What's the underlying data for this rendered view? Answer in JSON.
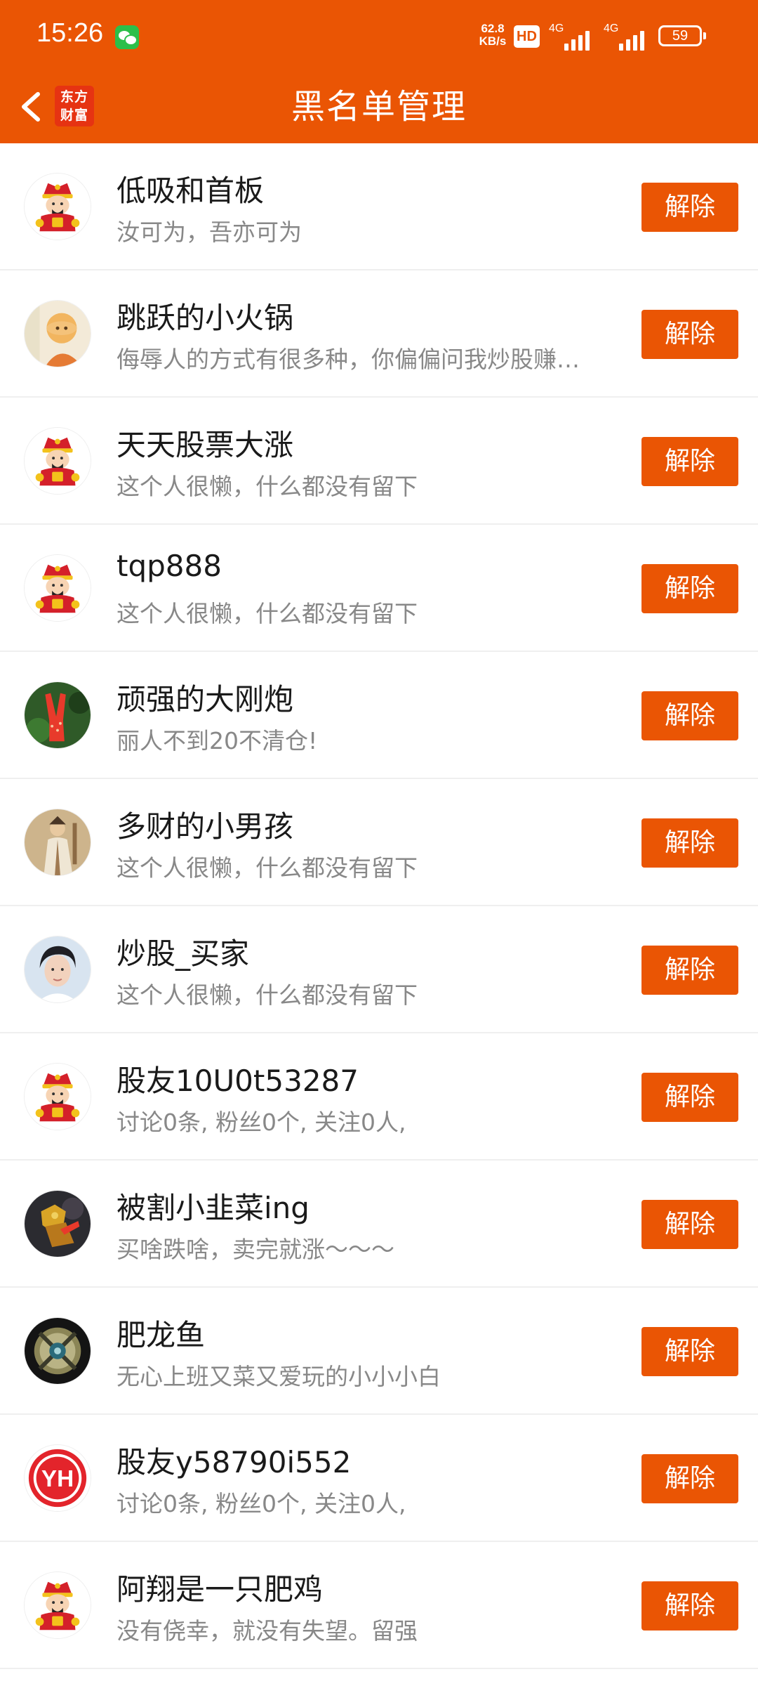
{
  "status_bar": {
    "time": "15:26",
    "net_speed_value": "62.8",
    "net_speed_unit": "KB/s",
    "hd_label": "HD",
    "network_1": "4G",
    "network_2": "4G",
    "battery": "59",
    "app_icon": "wechat-icon"
  },
  "header": {
    "title": "黑名单管理",
    "logo_line1": "东方",
    "logo_line2": "财富",
    "back_icon": "chevron-left-icon"
  },
  "colors": {
    "brand": "#ea5504",
    "button": "#ea5504",
    "name_text": "#1a1a1a",
    "bio_text": "#888888"
  },
  "blacklist": [
    {
      "name": "低吸和首板",
      "bio": "汝可为，吾亦可为",
      "avatar": "god-of-wealth-avatar",
      "action": "解除"
    },
    {
      "name": "跳跃的小火锅",
      "bio": "侮辱人的方式有很多种，你偏偏问我炒股赚…",
      "avatar": "cartoon-avatar",
      "action": "解除"
    },
    {
      "name": "天天股票大涨",
      "bio": "这个人很懒，什么都没有留下",
      "avatar": "god-of-wealth-avatar",
      "action": "解除"
    },
    {
      "name": "tqp888",
      "bio": "这个人很懒，什么都没有留下",
      "avatar": "god-of-wealth-avatar",
      "action": "解除"
    },
    {
      "name": "顽强的大刚炮",
      "bio": "丽人不到20不清仓!",
      "avatar": "victory-hand-avatar",
      "action": "解除"
    },
    {
      "name": "多财的小男孩",
      "bio": "这个人很懒，什么都没有留下",
      "avatar": "painting-avatar",
      "action": "解除"
    },
    {
      "name": "炒股_买家",
      "bio": "这个人很懒，什么都没有留下",
      "avatar": "person-photo-avatar",
      "action": "解除"
    },
    {
      "name": "股友10U0t53287",
      "bio": "讨论0条, 粉丝0个, 关注0人,",
      "avatar": "god-of-wealth-avatar",
      "action": "解除"
    },
    {
      "name": "被割小韭菜ing",
      "bio": "买啥跌啥，卖完就涨～～～",
      "avatar": "game-character-avatar",
      "action": "解除"
    },
    {
      "name": "肥龙鱼",
      "bio": "无心上班又菜又爱玩的小小小白",
      "avatar": "emblem-avatar",
      "action": "解除"
    },
    {
      "name": "股友y58790i552",
      "bio": "讨论0条, 粉丝0个, 关注0人,",
      "avatar": "yh-logo-avatar",
      "action": "解除"
    },
    {
      "name": "阿翔是一只肥鸡",
      "bio": "没有侥幸，就没有失望。留强",
      "avatar": "god-of-wealth-avatar",
      "action": "解除"
    }
  ],
  "avatar_text": {
    "yh": "YH"
  }
}
